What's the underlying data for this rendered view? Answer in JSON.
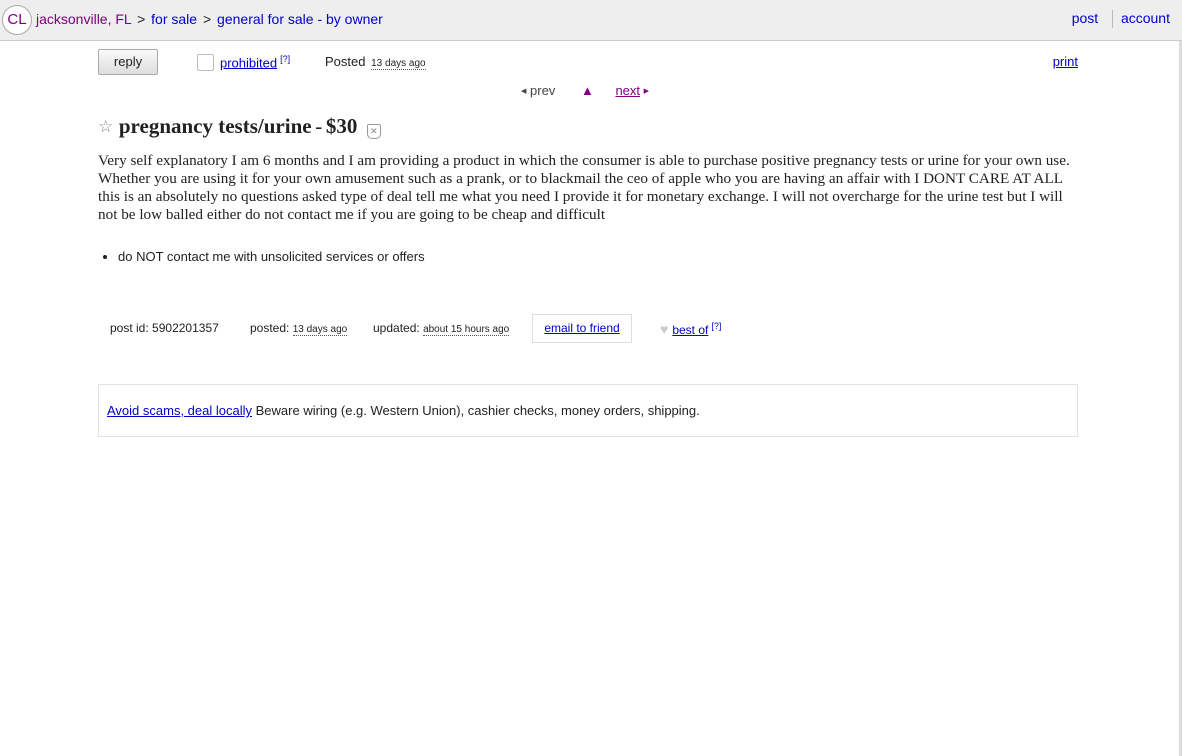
{
  "header": {
    "logo": "CL",
    "breadcrumbs": [
      {
        "label": "jacksonville, FL"
      },
      {
        "label": "for sale"
      },
      {
        "label": "general for sale - by owner"
      }
    ],
    "separator": ">",
    "post_link": "post",
    "account_link": "account"
  },
  "actions": {
    "reply_label": "reply",
    "prohibited_label": "prohibited",
    "prohibited_help": "[?]",
    "posted_label": "Posted",
    "posted_date": "13 days ago",
    "print_label": "print"
  },
  "pager": {
    "prev_arrow": "◀",
    "prev_label": "prev",
    "up_label": "▲",
    "next_label": "next",
    "next_arrow": "▶"
  },
  "posting": {
    "star": "☆",
    "title": "pregnancy tests/urine",
    "dash": "-",
    "price": "$30",
    "body": "Very self explanatory I am 6 months and I am providing a product in which the consumer is able to purchase positive pregnancy tests or urine for your own use. Whether you are using it for your own amusement such as a prank, or to blackmail the ceo of apple who you are having an affair with I DONT CARE AT ALL this is an absolutely no questions asked type of deal tell me what you need I provide it for monetary exchange. I will not overcharge for the urine test but I will not be low balled either do not contact me if you are going to be cheap and difficult",
    "notices": [
      "do NOT contact me with unsolicited services or offers"
    ]
  },
  "postinfo": {
    "post_id_label": "post id:",
    "post_id": "5902201357",
    "posted_label": "posted:",
    "posted_date": "13 days ago",
    "updated_label": "updated:",
    "updated_date": "about 15 hours ago",
    "email_label": "email to friend",
    "heart": "♥",
    "best_of_label": "best of",
    "best_of_help": "[?]"
  },
  "safety": {
    "link_label": "Avoid scams, deal locally",
    "text": "Beware wiring (e.g. Western Union), cashier checks, money orders, shipping."
  },
  "icons": {
    "logo": "cl-logo",
    "favorite": "star-icon",
    "hide": "hide-posting-icon",
    "heart": "heart-icon"
  }
}
